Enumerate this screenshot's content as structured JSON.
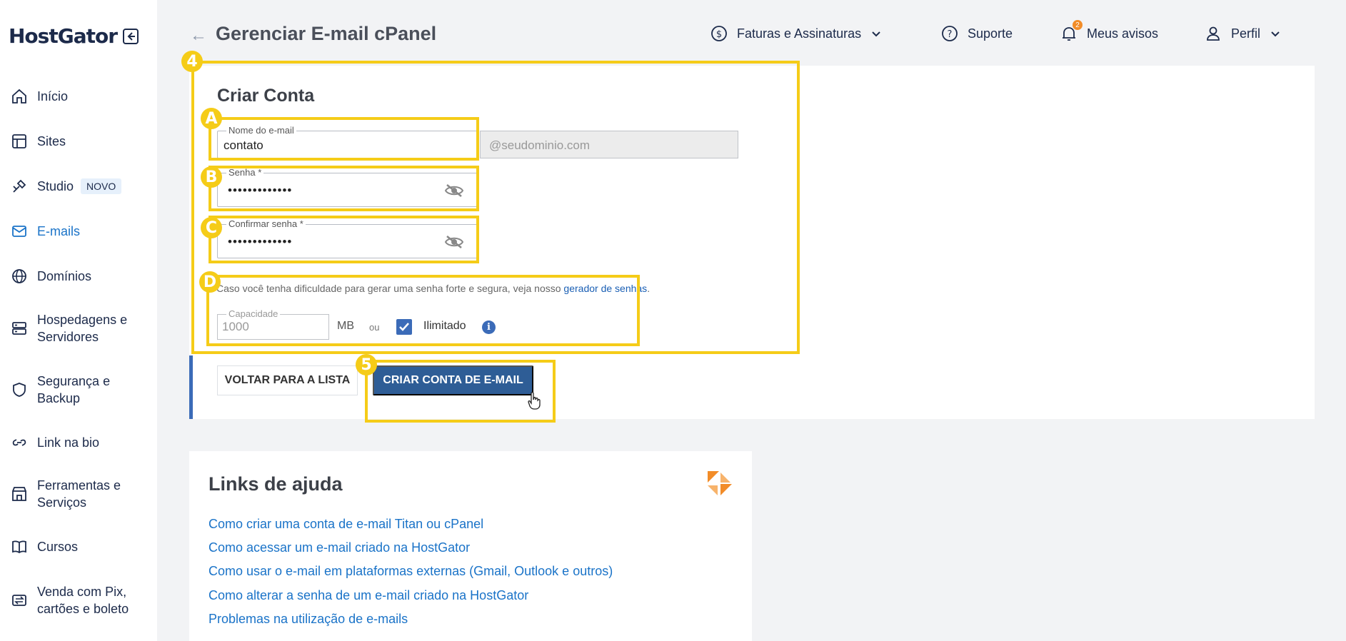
{
  "brand": {
    "logo_text": "HostGator"
  },
  "sidebar": {
    "items": [
      {
        "label": "Início",
        "icon": "home-icon"
      },
      {
        "label": "Sites",
        "icon": "layout-icon"
      },
      {
        "label": "Studio",
        "icon": "studio-icon",
        "badge": "NOVO"
      },
      {
        "label": "E-mails",
        "icon": "mail-icon",
        "active": true
      },
      {
        "label": "Domínios",
        "icon": "globe-icon"
      },
      {
        "label": "Hospedagens e Servidores",
        "icon": "server-icon"
      },
      {
        "label": "Segurança e Backup",
        "icon": "shield-icon"
      },
      {
        "label": "Link na bio",
        "icon": "link-icon"
      },
      {
        "label": "Ferramentas e Serviços",
        "icon": "store-icon"
      },
      {
        "label": "Cursos",
        "icon": "book-icon"
      },
      {
        "label": "Venda com Pix, cartões e boleto",
        "icon": "transfer-icon"
      }
    ]
  },
  "header": {
    "title": "Gerenciar E-mail cPanel",
    "billing_label": "Faturas e Assinaturas",
    "support_label": "Suporte",
    "notices_label": "Meus avisos",
    "notices_count": "2",
    "profile_label": "Perfil"
  },
  "form": {
    "title": "Criar Conta",
    "email_name_label": "Nome do e-mail",
    "email_name_value": "contato",
    "domain_placeholder": "@seudominio.com",
    "password_label": "Senha *",
    "password_value": "•••••••••••••",
    "confirm_label": "Confirmar senha *",
    "confirm_value": "•••••••••••••",
    "hint_text": "Caso você tenha dificuldade para gerar uma senha forte e segura, veja nosso ",
    "hint_link": "gerador de senhas",
    "hint_end": ".",
    "capacity_label": "Capacidade",
    "capacity_value": "1000",
    "capacity_unit": "MB",
    "or_label": "ou",
    "unlimited_label": "Ilimitado",
    "unlimited_checked": true,
    "info_glyph": "i",
    "back_button": "VOLTAR PARA A LISTA",
    "create_button": "CRIAR CONTA DE E-MAIL"
  },
  "callouts": {
    "four": "4",
    "a": "A",
    "b": "B",
    "c": "C",
    "d": "D",
    "five": "5"
  },
  "help": {
    "title": "Links de ajuda",
    "links": [
      "Como criar uma conta de e-mail Titan ou cPanel",
      "Como acessar um e-mail criado na HostGator",
      "Como usar o e-mail em plataformas externas (Gmail, Outlook e outros)",
      "Como alterar a senha de um e-mail criado na HostGator",
      "Problemas na utilização de e-mails"
    ]
  },
  "colors": {
    "accent": "#2e5d96",
    "link": "#1a73c8",
    "callout": "#f5cc18",
    "badge": "#f28c28"
  }
}
